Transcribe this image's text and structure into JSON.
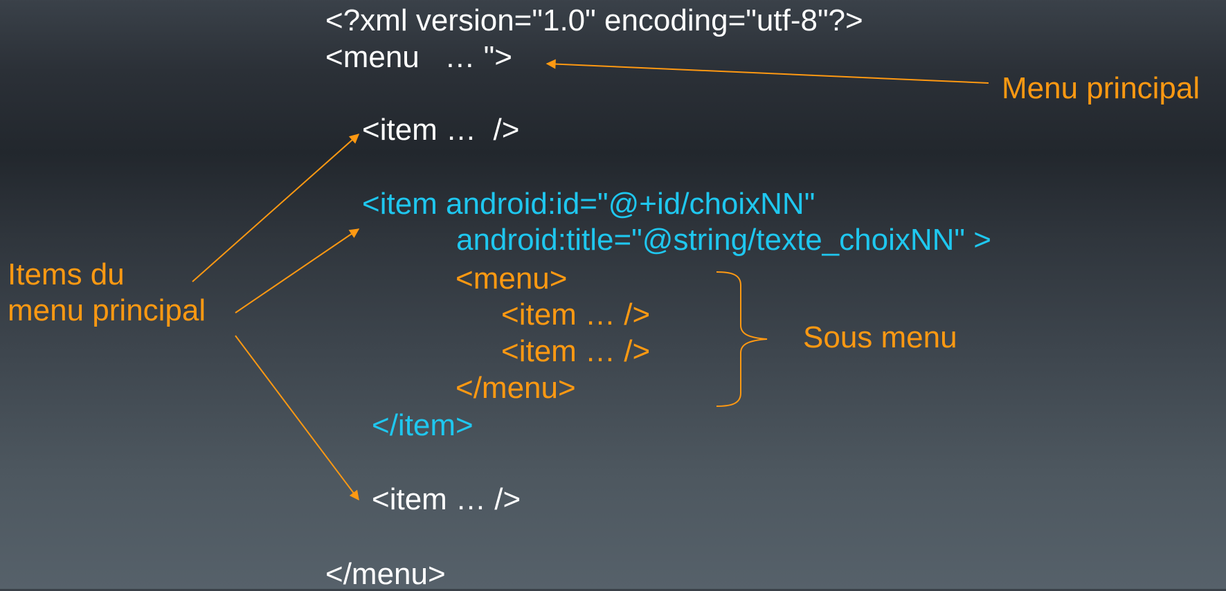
{
  "code": {
    "xml_decl": "<?xml version=\"1.0\" encoding=\"utf-8\"?>",
    "menu_open": "<menu   … \">",
    "item_first": "<item …  />",
    "item_id": "<item android:id=\"@+id/choixNN\"",
    "item_title": "android:title=\"@string/texte_choixNN\" >",
    "submenu_open": "<menu>",
    "submenu_item_1": "<item … />",
    "submenu_item_2": "<item … />",
    "submenu_close": "</menu>",
    "item_close": "</item>",
    "item_last": "<item … />",
    "menu_close": "</menu>"
  },
  "annotations": {
    "menu_principal": "Menu principal",
    "items_line1": "Items du",
    "items_line2": "menu principal",
    "sous_menu": "Sous menu"
  },
  "colors": {
    "code_default": "#ffffff",
    "code_highlight": "#1fc7ef",
    "annotation": "#ff9912"
  }
}
